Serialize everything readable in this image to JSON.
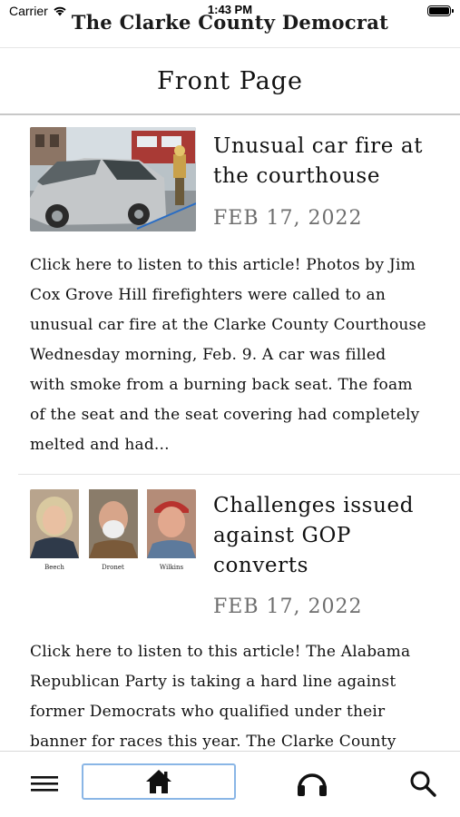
{
  "status_bar": {
    "carrier": "Carrier",
    "time": "1:43 PM"
  },
  "masthead": {
    "title": "The Clarke County Democrat"
  },
  "page": {
    "title": "Front Page"
  },
  "articles": [
    {
      "headline_lines": [
        "Unusual car fire at",
        "the courthouse"
      ],
      "date": "FEB 17, 2022",
      "excerpt_lines": [
        "Click here to listen to this article! Photos by Jim",
        "Cox Grove Hill firefighters were called to an",
        "unusual car fire at the Clarke County Courthouse",
        "Wednesday morning, Feb. 9. A car was filled",
        "with smoke from a burning back seat. The foam",
        "of the seat and the seat covering had completely",
        "melted and had..."
      ]
    },
    {
      "headline_lines": [
        "Challenges issued",
        "against GOP",
        "converts"
      ],
      "date": "FEB 17, 2022",
      "photo_captions": [
        "Beech",
        "Dronet",
        "Wilkins"
      ],
      "excerpt_lines": [
        "Click here to listen to this article!   The Alabama",
        "Republican Party is taking a hard line against",
        "former Democrats who qualified under their",
        "banner for races this year. The Clarke County"
      ]
    }
  ],
  "tab_bar": {
    "items": [
      {
        "icon": "menu-icon"
      },
      {
        "icon": "home-icon",
        "selected": true
      },
      {
        "icon": "headphones-icon"
      },
      {
        "icon": "search-icon"
      }
    ],
    "highlight_color": "#8ab6e6"
  }
}
